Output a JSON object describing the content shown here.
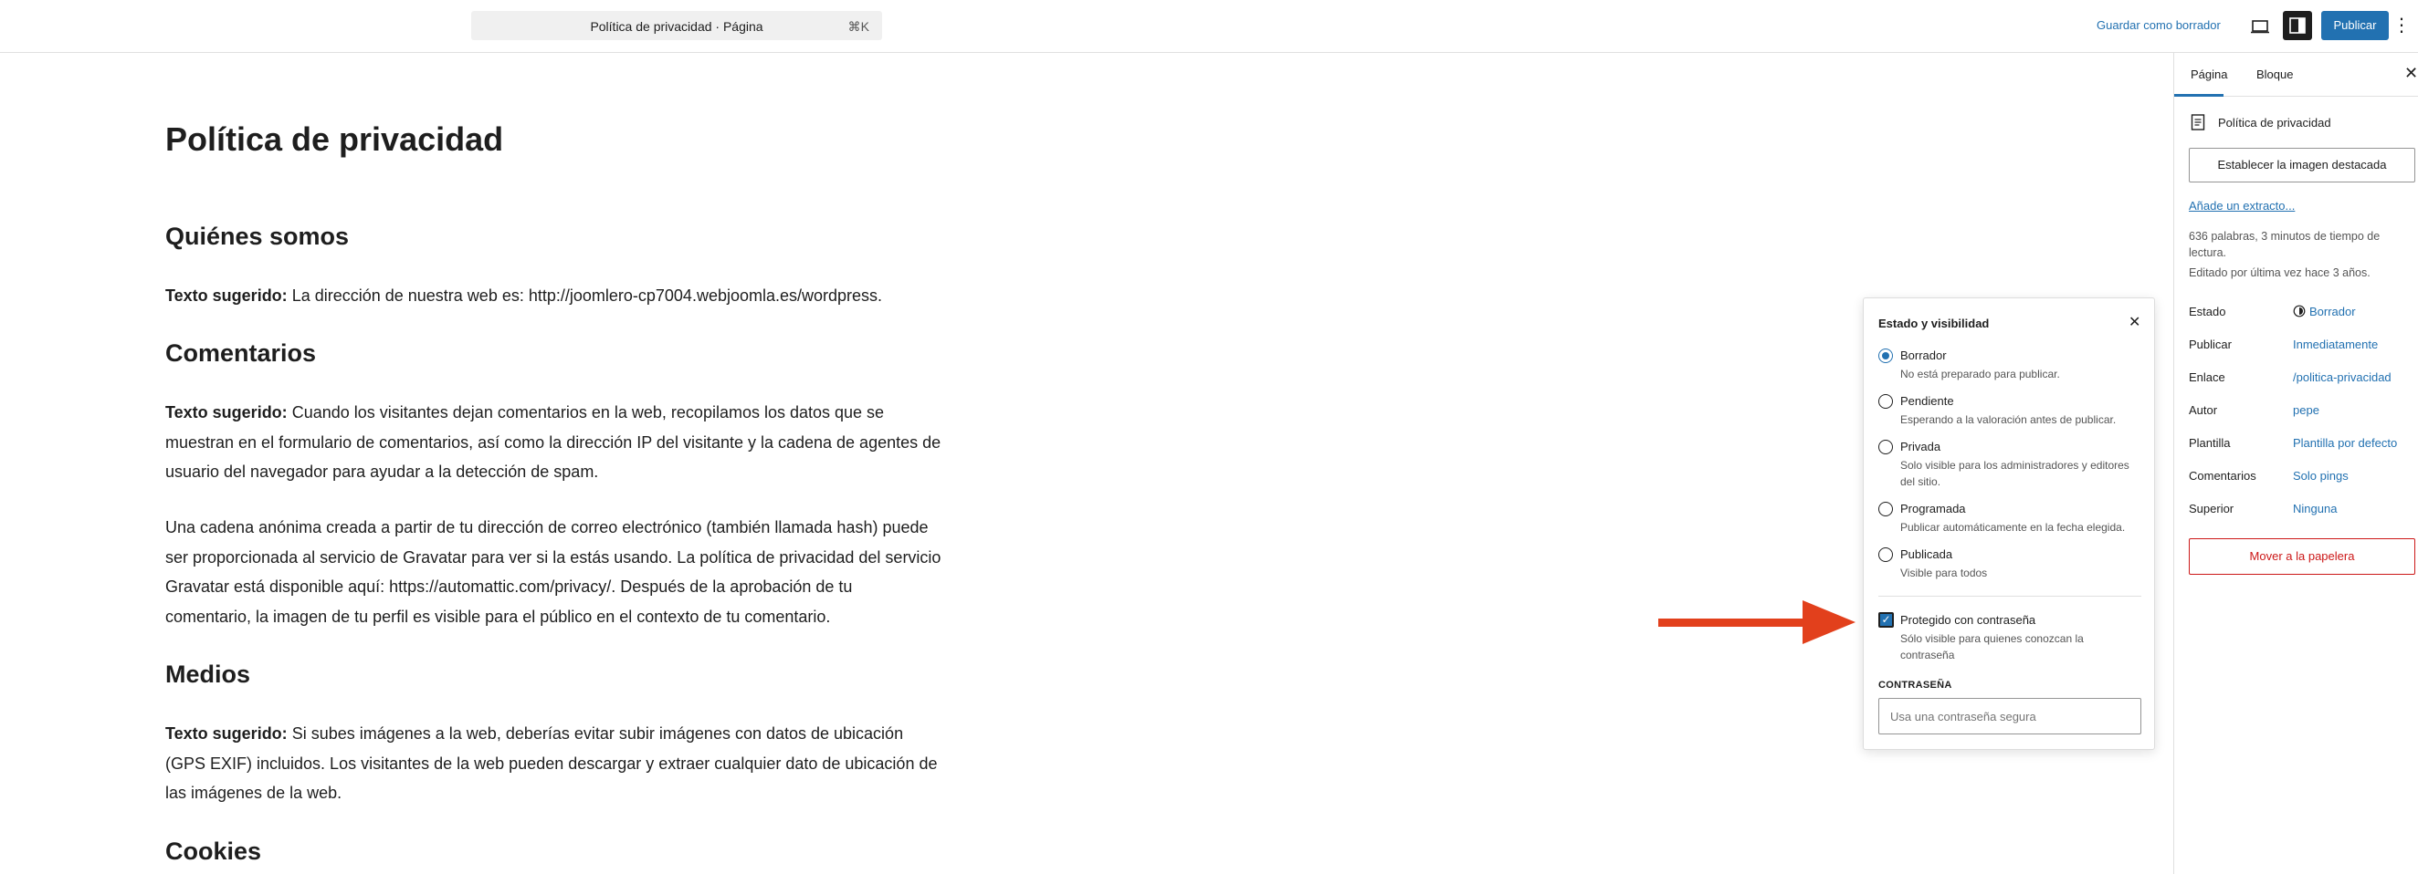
{
  "topbar": {
    "command_title": "Política de privacidad · Página",
    "command_shortcut": "⌘K",
    "save_draft": "Guardar como borrador",
    "publish": "Publicar",
    "more": "⋮"
  },
  "post": {
    "title": "Política de privacidad",
    "sections": [
      {
        "heading": "Quiénes somos",
        "paragraphs": [
          {
            "bold": "Texto sugerido:",
            "text": " La dirección de nuestra web es: http://joomlero-cp7004.webjoomla.es/wordpress."
          }
        ]
      },
      {
        "heading": "Comentarios",
        "paragraphs": [
          {
            "bold": "Texto sugerido:",
            "text": " Cuando los visitantes dejan comentarios en la web, recopilamos los datos que se muestran en el formulario de comentarios, así como la dirección IP del visitante y la cadena de agentes de usuario del navegador para ayudar a la detección de spam."
          },
          {
            "bold": "",
            "text": "Una cadena anónima creada a partir de tu dirección de correo electrónico (también llamada hash) puede ser proporcionada al servicio de Gravatar para ver si la estás usando. La política de privacidad del servicio Gravatar está disponible aquí: https://automattic.com/privacy/. Después de la aprobación de tu comentario, la imagen de tu perfil es visible para el público en el contexto de tu comentario."
          }
        ]
      },
      {
        "heading": "Medios",
        "paragraphs": [
          {
            "bold": "Texto sugerido:",
            "text": " Si subes imágenes a la web, deberías evitar subir imágenes con datos de ubicación (GPS EXIF) incluidos. Los visitantes de la web pueden descargar y extraer cualquier dato de ubicación de las imágenes de la web."
          }
        ]
      },
      {
        "heading": "Cookies",
        "paragraphs": []
      }
    ]
  },
  "sidebar": {
    "tabs": [
      "Página",
      "Bloque"
    ],
    "close": "✕",
    "doc_title": "Política de privacidad",
    "featured_image": "Establecer la imagen destacada",
    "excerpt_link": "Añade un extracto...",
    "stats": "636 palabras, 3 minutos de tiempo de lectura.",
    "last_edited": "Editado por última vez hace 3 años.",
    "properties": [
      {
        "key": "Estado",
        "value": "Borrador"
      },
      {
        "key": "Publicar",
        "value": "Inmediatamente"
      },
      {
        "key": "Enlace",
        "value": "/politica-privacidad"
      },
      {
        "key": "Autor",
        "value": "pepe"
      },
      {
        "key": "Plantilla",
        "value": "Plantilla por defecto"
      },
      {
        "key": "Comentarios",
        "value": "Solo pings"
      },
      {
        "key": "Superior",
        "value": "Ninguna"
      }
    ],
    "trash": "Mover a la papelera"
  },
  "popover": {
    "title": "Estado y visibilidad",
    "close": "✕",
    "options": [
      {
        "name": "Borrador",
        "desc": "No está preparado para publicar.",
        "selected": true
      },
      {
        "name": "Pendiente",
        "desc": "Esperando a la valoración antes de publicar.",
        "selected": false
      },
      {
        "name": "Privada",
        "desc": "Solo visible para los administradores y editores del sitio.",
        "selected": false
      },
      {
        "name": "Programada",
        "desc": "Publicar automáticamente en la fecha elegida.",
        "selected": false
      },
      {
        "name": "Publicada",
        "desc": "Visible para todos",
        "selected": false
      }
    ],
    "password_protected": {
      "label": "Protegido con contraseña",
      "desc": "Sólo visible para quienes conozcan la contraseña",
      "checked": true
    },
    "password_label": "CONTRASEÑA",
    "password_placeholder": "Usa una contraseña segura"
  },
  "colors": {
    "accent": "#2271b1",
    "danger": "#cc1818",
    "arrow": "#e2401c"
  }
}
